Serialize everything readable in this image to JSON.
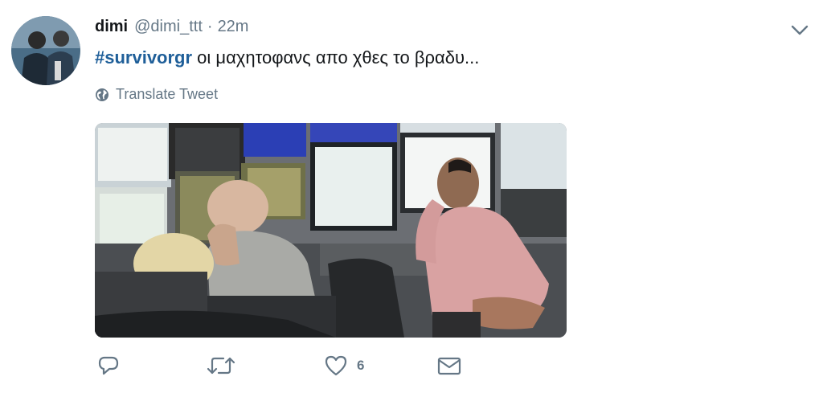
{
  "tweet": {
    "display_name": "dimi",
    "handle": "@dimi_ttt",
    "separator": "·",
    "timestamp": "22m",
    "hashtag": "#survivorgr",
    "body": " οι μαχητοφανς απο χθες το βραδυ...",
    "translate_label": "Translate Tweet",
    "like_count": "6"
  },
  "icons": {
    "reply": "reply-icon",
    "retweet": "retweet-icon",
    "like": "heart-icon",
    "message": "envelope-icon",
    "translate": "globe-icon",
    "menu": "chevron-down-icon"
  },
  "colors": {
    "hashtag": "#1f5f99",
    "muted": "#657786",
    "text": "#14171a"
  }
}
